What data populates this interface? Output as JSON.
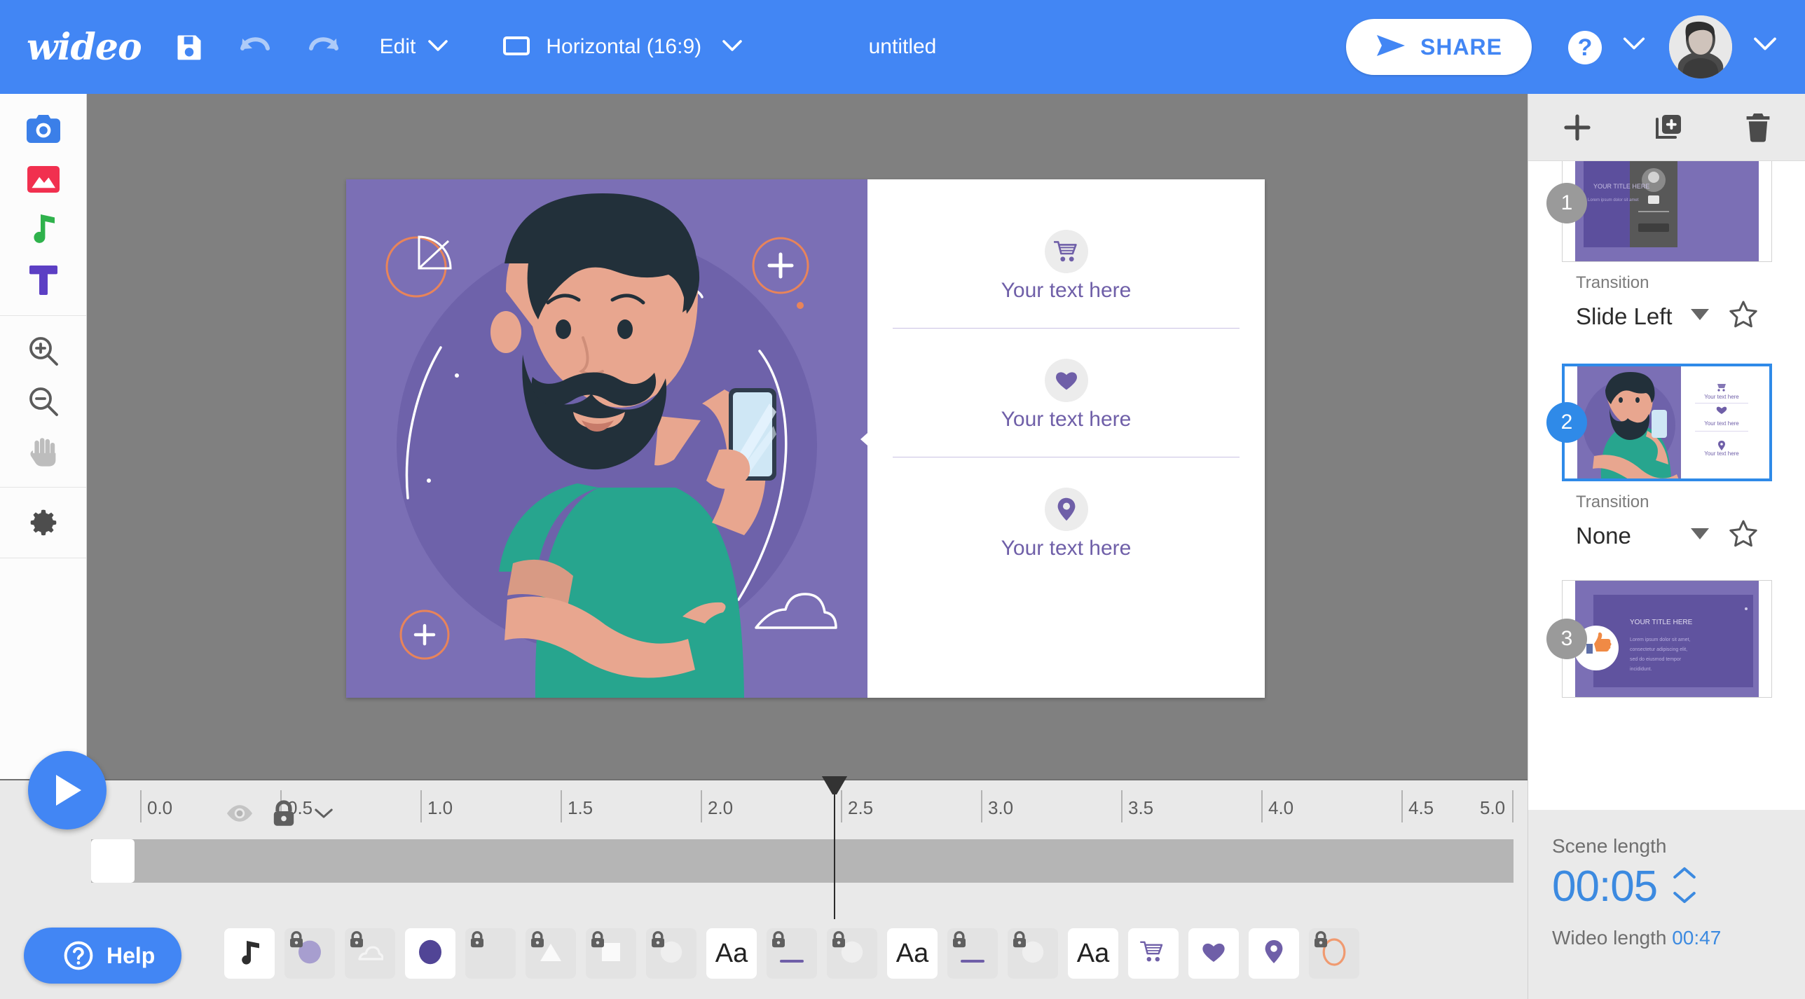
{
  "topbar": {
    "logo": "wideo",
    "save_icon": "save-disk-icon",
    "undo_icon": "undo-icon",
    "redo_icon": "redo-icon",
    "edit_label": "Edit",
    "ratio_icon": "rectangle-icon",
    "ratio_label": "Horizontal (16:9)",
    "project_title": "untitled",
    "share_label": "SHARE",
    "share_icon": "send-icon",
    "help_icon": "question-mark-icon",
    "avatar": "user-avatar"
  },
  "rail": {
    "groups": [
      {
        "items": [
          {
            "name": "camera-icon",
            "label": "Camera"
          },
          {
            "name": "image-icon",
            "label": "Image"
          },
          {
            "name": "music-note-icon",
            "label": "Music"
          },
          {
            "name": "text-icon",
            "label": "Text"
          }
        ]
      },
      {
        "items": [
          {
            "name": "zoom-in-icon",
            "label": "Zoom in"
          },
          {
            "name": "zoom-out-icon",
            "label": "Zoom out"
          },
          {
            "name": "hand-icon",
            "label": "Pan"
          }
        ]
      },
      {
        "items": [
          {
            "name": "gear-icon",
            "label": "Settings"
          }
        ]
      }
    ]
  },
  "canvas": {
    "features": [
      {
        "icon": "shopping-cart-icon",
        "text": "Your text here"
      },
      {
        "icon": "heart-icon",
        "text": "Your text here"
      },
      {
        "icon": "location-pin-icon",
        "text": "Your text here"
      }
    ],
    "illustration": "bearded-man-with-smartphone"
  },
  "scenes": {
    "toolbar": [
      {
        "name": "add-scene-button",
        "icon": "plus-icon"
      },
      {
        "name": "duplicate-scene-button",
        "icon": "duplicate-icon"
      },
      {
        "name": "delete-scene-button",
        "icon": "trash-icon"
      }
    ],
    "transition_label": "Transition",
    "items": [
      {
        "number": "1",
        "selected": false,
        "transition": "Slide Left",
        "thumb": "title-slide-with-phone"
      },
      {
        "number": "2",
        "selected": true,
        "transition": "None",
        "thumb": "man-with-phone-features"
      },
      {
        "number": "3",
        "selected": false,
        "transition": "",
        "thumb": "title-with-thumbs-up"
      }
    ],
    "scene_length_label": "Scene length",
    "scene_length_value": "00:05",
    "wideo_length_label": "Wideo length",
    "wideo_length_value": "00:47"
  },
  "timeline": {
    "play_icon": "play-icon",
    "ticks": [
      "0.0",
      "0.5",
      "1.0",
      "1.5",
      "2.0",
      "2.5",
      "3.0",
      "3.5",
      "4.0",
      "4.5",
      "5.0"
    ],
    "playhead_time": "2.5",
    "eye_icon": "eye-icon",
    "lock_icon": "lock-icon",
    "lock_caret_icon": "chevron-down-icon",
    "layers": [
      {
        "icon": "music-note-icon",
        "locked": false,
        "active": true
      },
      {
        "icon": "circle-icon",
        "locked": true,
        "active": false
      },
      {
        "icon": "cloud-icon",
        "locked": true,
        "active": false
      },
      {
        "icon": "circle-icon",
        "locked": false,
        "active": true
      },
      {
        "icon": "blank-icon",
        "locked": true,
        "active": false
      },
      {
        "icon": "triangle-icon",
        "locked": true,
        "active": false
      },
      {
        "icon": "square-icon",
        "locked": true,
        "active": false
      },
      {
        "icon": "circle-icon",
        "locked": true,
        "active": false
      },
      {
        "icon": "text-aa-icon",
        "locked": false,
        "active": true
      },
      {
        "icon": "underline-icon",
        "locked": true,
        "active": false
      },
      {
        "icon": "circle-icon",
        "locked": true,
        "active": false
      },
      {
        "icon": "text-aa-icon",
        "locked": false,
        "active": true
      },
      {
        "icon": "underline-icon",
        "locked": true,
        "active": false
      },
      {
        "icon": "circle-icon",
        "locked": true,
        "active": false
      },
      {
        "icon": "text-aa-icon",
        "locked": false,
        "active": true
      },
      {
        "icon": "shopping-cart-icon",
        "locked": false,
        "active": true
      },
      {
        "icon": "heart-icon",
        "locked": false,
        "active": true
      },
      {
        "icon": "location-pin-icon",
        "locked": false,
        "active": true
      },
      {
        "icon": "ellipse-outline-icon",
        "locked": true,
        "active": false
      }
    ]
  },
  "help": {
    "label": "Help",
    "icon": "question-circle-icon"
  },
  "colors": {
    "brand_blue": "#4286f4",
    "canvas_purple": "#7b6fb5",
    "accent_purple": "#6f5fa8",
    "stage_gray": "#808080"
  }
}
